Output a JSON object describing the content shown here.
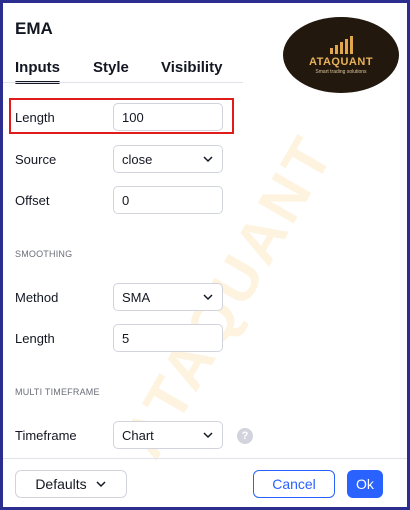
{
  "dialog": {
    "title": "EMA"
  },
  "tabs": [
    {
      "label": "Inputs",
      "active": true
    },
    {
      "label": "Style",
      "active": false
    },
    {
      "label": "Visibility",
      "active": false
    }
  ],
  "inputs": {
    "length": {
      "label": "Length",
      "value": "100"
    },
    "source": {
      "label": "Source",
      "value": "close"
    },
    "offset": {
      "label": "Offset",
      "value": "0"
    }
  },
  "smoothing": {
    "section_label": "SMOOTHING",
    "method": {
      "label": "Method",
      "value": "SMA"
    },
    "length": {
      "label": "Length",
      "value": "5"
    }
  },
  "multi_timeframe": {
    "section_label": "MULTI TIMEFRAME",
    "timeframe": {
      "label": "Timeframe",
      "value": "Chart"
    },
    "help_icon": "?"
  },
  "footer": {
    "defaults_label": "Defaults",
    "cancel_label": "Cancel",
    "ok_label": "Ok"
  },
  "branding": {
    "logo_text": "ATAQUANT",
    "logo_tagline": "Smart trading solutions",
    "watermark_text": "ATAQUANT"
  },
  "colors": {
    "accent": "#2962ff",
    "highlight": "#e01b1b",
    "frame": "#2b2d8f"
  }
}
